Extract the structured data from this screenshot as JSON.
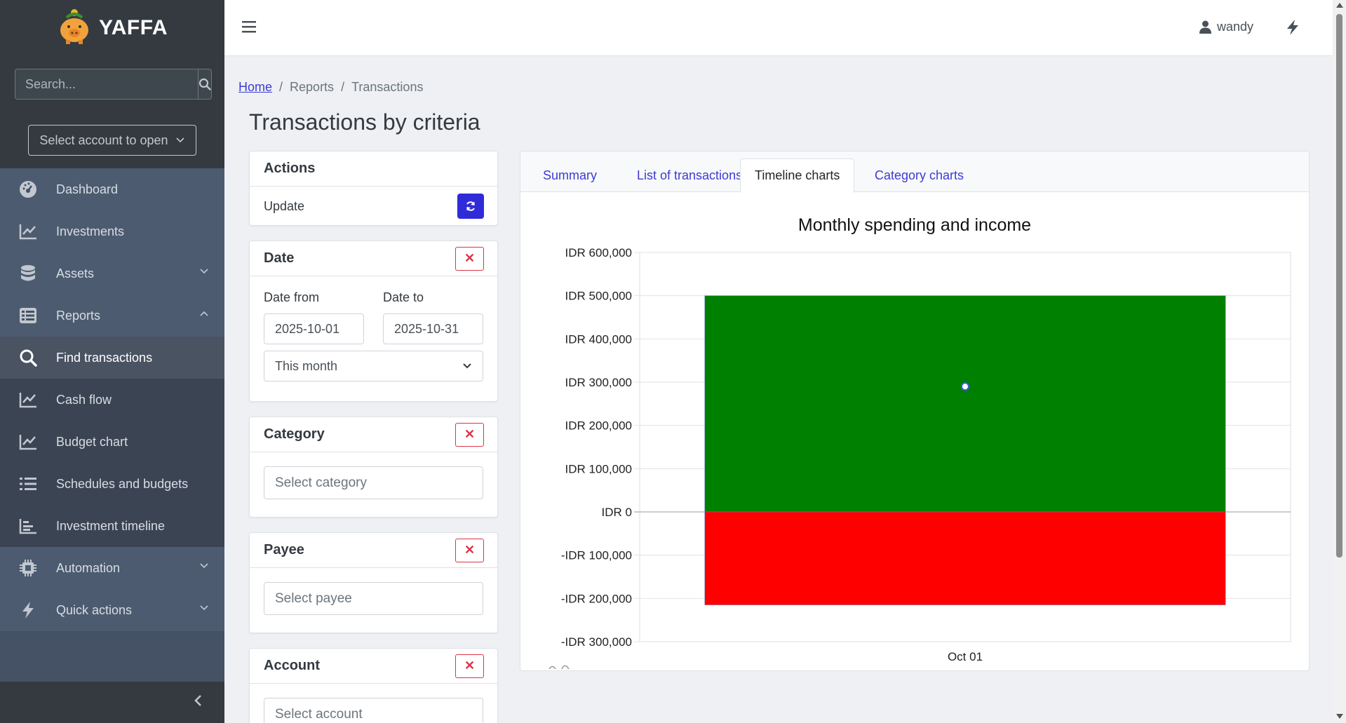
{
  "app": {
    "brand": "YAFFA"
  },
  "sidebar": {
    "search_placeholder": "Search...",
    "account_select": "Select account to open",
    "items": [
      {
        "label": "Dashboard",
        "icon": "dashboard-icon"
      },
      {
        "label": "Investments",
        "icon": "chart-line-icon"
      },
      {
        "label": "Assets",
        "icon": "database-icon"
      },
      {
        "label": "Reports",
        "icon": "list-icon"
      },
      {
        "label": "Find transactions",
        "icon": "search-icon"
      },
      {
        "label": "Cash flow",
        "icon": "chart-line-icon"
      },
      {
        "label": "Budget chart",
        "icon": "chart-line-icon"
      },
      {
        "label": "Schedules and budgets",
        "icon": "list-icon"
      },
      {
        "label": "Investment timeline",
        "icon": "chart-bars-icon"
      },
      {
        "label": "Automation",
        "icon": "chip-icon"
      },
      {
        "label": "Quick actions",
        "icon": "bolt-icon"
      }
    ]
  },
  "topbar": {
    "user": "wandy"
  },
  "breadcrumb": {
    "home": "Home",
    "reports": "Reports",
    "current": "Transactions"
  },
  "page": {
    "title": "Transactions by criteria"
  },
  "filters": {
    "actions": {
      "title": "Actions",
      "update": "Update"
    },
    "date": {
      "title": "Date",
      "from_label": "Date from",
      "to_label": "Date to",
      "from_value": "2025-10-01",
      "to_value": "2025-10-31",
      "range": "This month"
    },
    "category": {
      "title": "Category",
      "placeholder": "Select category"
    },
    "payee": {
      "title": "Payee",
      "placeholder": "Select payee"
    },
    "account": {
      "title": "Account",
      "placeholder": "Select account"
    }
  },
  "tabs": [
    "Summary",
    "List of transactions",
    "Timeline charts",
    "Category charts"
  ],
  "colors": {
    "income": "#008000",
    "spending": "#ff0000",
    "accent": "#3d3bd5",
    "sidebar": "#343a40"
  },
  "chart_data": {
    "type": "bar",
    "title": "Monthly spending and income",
    "categories": [
      "Oct 01"
    ],
    "series": [
      {
        "values": [
          500000
        ],
        "color": "#008000"
      },
      {
        "values": [
          -215000
        ],
        "color": "#ff0000"
      }
    ],
    "balance_point": [
      290000
    ],
    "ylim": [
      -300000,
      600000
    ],
    "yticks": [
      600000,
      500000,
      400000,
      300000,
      200000,
      100000,
      0,
      -100000,
      -200000,
      -300000
    ],
    "ytick_labels": [
      "IDR 600,000",
      "IDR 500,000",
      "IDR 400,000",
      "IDR 300,000",
      "IDR 200,000",
      "IDR 100,000",
      "IDR 0",
      "-IDR 100,000",
      "-IDR 200,000",
      "-IDR 300,000"
    ],
    "grid": true
  }
}
